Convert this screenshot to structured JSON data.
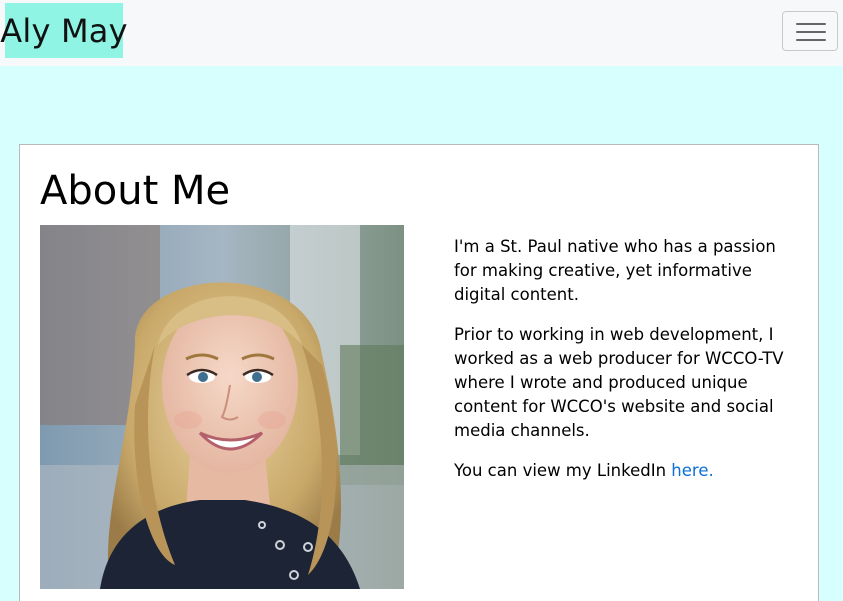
{
  "navbar": {
    "brand": "Aly May",
    "menu_icon": "hamburger-menu-icon"
  },
  "about": {
    "title": "About Me",
    "paragraph_1": "I'm a St. Paul native who has a passion for making creative, yet informative digital content.",
    "paragraph_2": "Prior to working in web development, I worked as a web producer for WCCO-TV where I wrote and produced unique content for WCCO's website and social media channels.",
    "paragraph_3_prefix": "You can view my LinkedIn ",
    "linkedin_link": "here."
  },
  "colors": {
    "page_background": "#d6fffe",
    "navbar_background": "#f7f8f9",
    "brand_background": "#8ff4e3",
    "link": "#0a6fd8"
  }
}
